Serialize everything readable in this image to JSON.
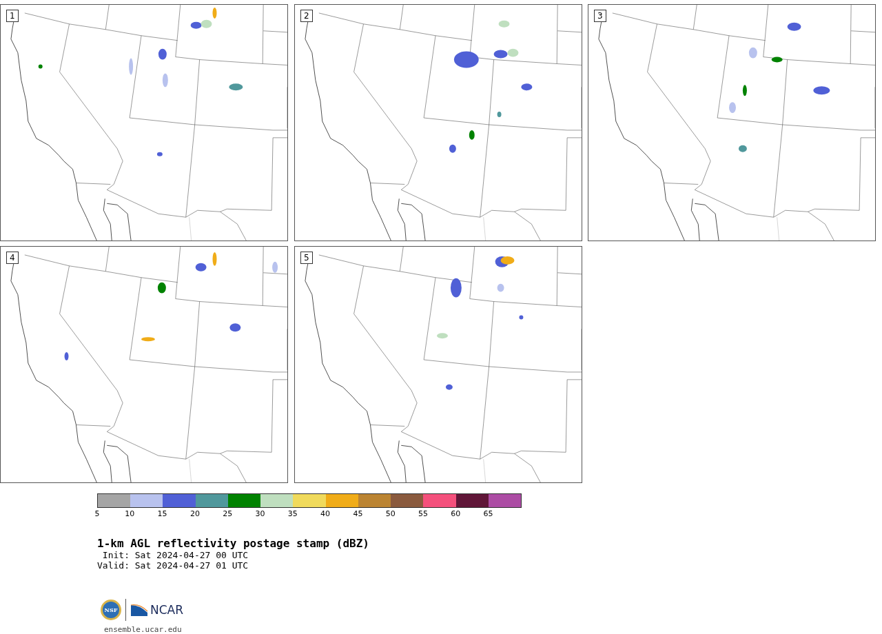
{
  "panels": [
    {
      "label": "1"
    },
    {
      "label": "2"
    },
    {
      "label": "3"
    },
    {
      "label": "4"
    },
    {
      "label": "5"
    }
  ],
  "colorbar": {
    "segments": [
      {
        "color": "#a5a5a5"
      },
      {
        "color": "#b8c2ee"
      },
      {
        "color": "#5060d6"
      },
      {
        "color": "#50989c"
      },
      {
        "color": "#008200"
      },
      {
        "color": "#bfdfbf"
      },
      {
        "color": "#f0da5c"
      },
      {
        "color": "#f0ac18"
      },
      {
        "color": "#bb8432"
      },
      {
        "color": "#8a5a3e"
      },
      {
        "color": "#f4507c"
      },
      {
        "color": "#601638"
      },
      {
        "color": "#ac4ca4"
      }
    ],
    "ticks": [
      "5",
      "10",
      "15",
      "20",
      "25",
      "30",
      "35",
      "40",
      "45",
      "50",
      "55",
      "60",
      "65"
    ]
  },
  "title": "1-km AGL reflectivity postage stamp (dBZ)",
  "init": " Init: Sat 2024-04-27 00 UTC",
  "valid": "Valid: Sat 2024-04-27 01 UTC",
  "logo": {
    "seal": "NSF",
    "name": "NCAR"
  },
  "url": "ensemble.ucar.edu"
}
